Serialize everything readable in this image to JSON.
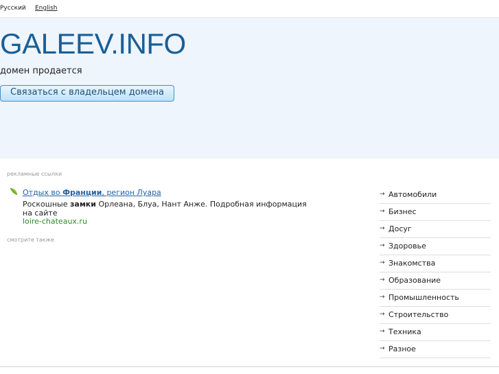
{
  "lang": {
    "ru_label": "Русский",
    "en_label": "English"
  },
  "hero": {
    "domain": "GALEEV.INFO",
    "subtitle": "домен продается",
    "contact_button": "Связаться с владельцем домена"
  },
  "ads": {
    "label": "рекламные ссылки",
    "items": [
      {
        "title_pre": "Отдых во ",
        "title_bold": "Франции",
        "title_post": ", регион Луара",
        "desc_pre": "Роскошные ",
        "desc_bold": "замки",
        "desc_post": " Орлеана, Блуа, Нант Анже. Подробная информация на сайте",
        "url": "loire-chateaux.ru"
      }
    ]
  },
  "see_also": {
    "label": "смотрите также"
  },
  "categories": [
    {
      "label": "Автомобили"
    },
    {
      "label": "Бизнес"
    },
    {
      "label": "Досуг"
    },
    {
      "label": "Здоровье"
    },
    {
      "label": "Знакомства"
    },
    {
      "label": "Образование"
    },
    {
      "label": "Промышленность"
    },
    {
      "label": "Строительство"
    },
    {
      "label": "Техника"
    },
    {
      "label": "Разное"
    }
  ],
  "icons": {
    "ad_leaf": "leaf-icon",
    "category_arrow": "arrow-right-icon"
  },
  "colors": {
    "hero_bg": "#eef5fc",
    "title": "#1b5e97",
    "link": "#1f62a8",
    "url": "#2b8a2b"
  }
}
